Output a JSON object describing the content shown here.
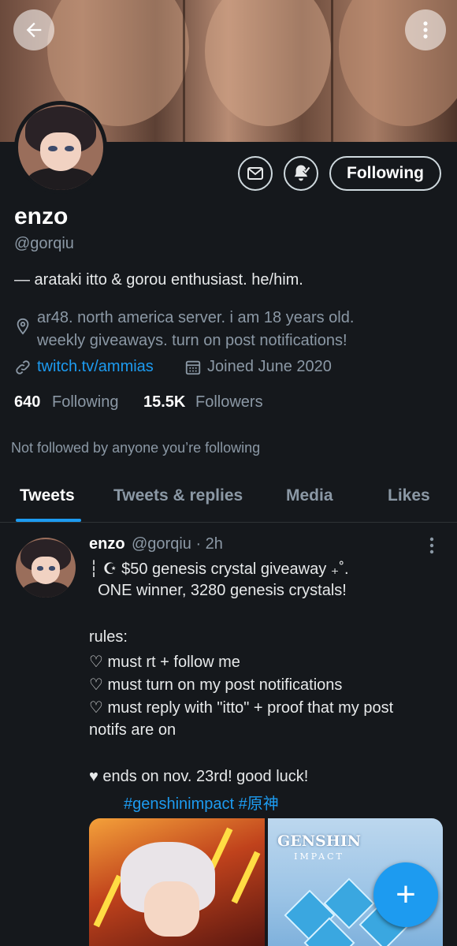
{
  "header": {
    "back_icon": "arrow-left-icon",
    "more_icon": "more-vertical-icon"
  },
  "profile": {
    "name": "enzo",
    "handle": "@gorqiu",
    "bio": "— arataki itto & gorou enthusiast. he/him.",
    "location_line1": "ar48. north america server. i am 18 years old.",
    "location_line2": "weekly giveaways. turn on post notifications!",
    "link": "twitch.tv/ammias",
    "joined": "Joined June 2020",
    "following_count": "640",
    "following_label": "Following",
    "followers_count": "15.5K",
    "followers_label": "Followers",
    "not_followed_text": "Not followed by anyone you’re following",
    "follow_button_label": "Following",
    "accent_color": "#1d9bf0"
  },
  "tabs": [
    {
      "label": "Tweets",
      "active": true
    },
    {
      "label": "Tweets & replies",
      "active": false
    },
    {
      "label": "Media",
      "active": false
    },
    {
      "label": "Likes",
      "active": false
    }
  ],
  "tweet": {
    "name": "enzo",
    "meta": "@gorqiu · 2h",
    "lines": [
      "┆ ☪ $50 genesis crystal giveaway ₊˚.",
      "  ONE winner, 3280 genesis crystals!",
      "",
      "rules:",
      "♡ must rt + follow me",
      "♡ must turn on my post notifications",
      "♡ must reply with \"itto\" + proof that my post",
      "notifs are on",
      "",
      "♥ ends on nov. 23rd! good luck!"
    ],
    "hashtags": "#genshinimpact #原神",
    "media2_logo": "GENSHIN",
    "media2_logo_sub": "IMPACT"
  },
  "fab": {
    "label": "+"
  }
}
